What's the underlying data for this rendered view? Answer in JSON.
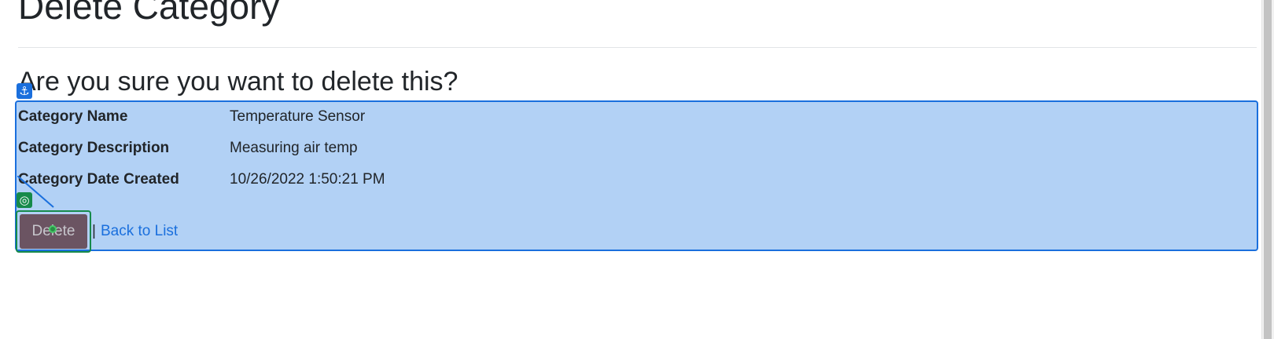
{
  "page": {
    "title": "Delete Category",
    "question": "Are you sure you want to delete this?"
  },
  "details": [
    {
      "label": "Category Name",
      "value": "Temperature Sensor"
    },
    {
      "label": "Category Description",
      "value": "Measuring air temp"
    },
    {
      "label": "Category Date Created",
      "value": "10/26/2022 1:50:21 PM"
    }
  ],
  "actions": {
    "delete_label": "Delete",
    "separator": "|",
    "back_label": "Back to List"
  },
  "overlay": {
    "anchor_icon": "⚓",
    "target_icon": "◎",
    "colors": {
      "selection_fill": "#b2d1f5",
      "selection_border": "#1a6fdd",
      "target_border": "#168a4a"
    }
  }
}
